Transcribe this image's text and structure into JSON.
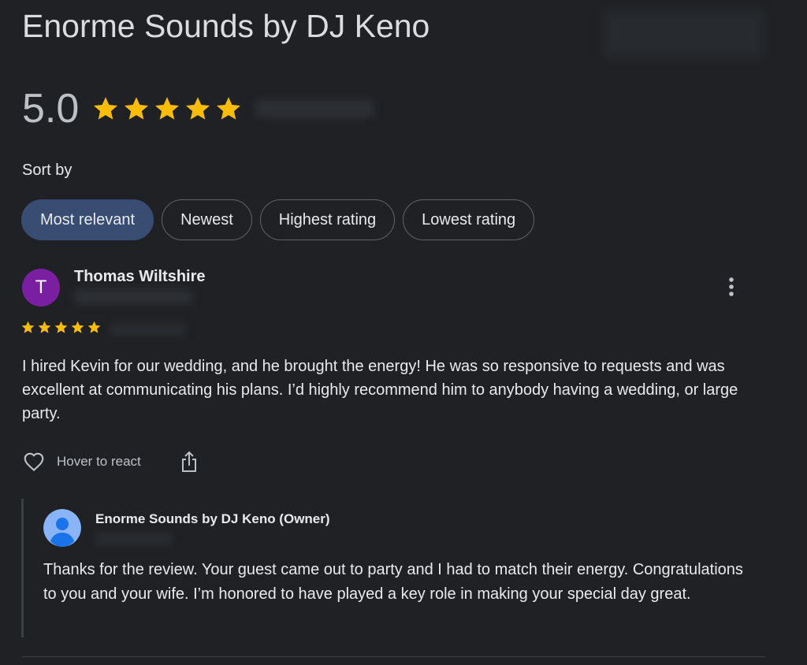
{
  "business": {
    "name": "Enorme Sounds by DJ Keno",
    "rating": "5.0",
    "stars": 5
  },
  "sort": {
    "label": "Sort by",
    "options": [
      {
        "label": "Most relevant",
        "selected": true
      },
      {
        "label": "Newest",
        "selected": false
      },
      {
        "label": "Highest rating",
        "selected": false
      },
      {
        "label": "Lowest rating",
        "selected": false
      }
    ]
  },
  "review": {
    "avatar_initial": "T",
    "avatar_color": "#7b1fa2",
    "reviewer_name": "Thomas Wiltshire",
    "stars": 5,
    "text": "I hired Kevin for our wedding, and he brought the energy! He was so responsive to requests and was excellent at communicating his plans. I’d highly recommend him to anybody having a wedding, or large party.",
    "react_label": "Hover to react",
    "icons": [
      "heart-outline-icon",
      "share-icon",
      "more-vert-icon"
    ]
  },
  "owner_reply": {
    "name": "Enorme Sounds by DJ Keno (Owner)",
    "text": "Thanks for the review. Your guest came out to party and I had to match their energy. Congratulations to you and your wife. I’m honored to have played a key role in making your special day great.",
    "avatar_icon": "default-profile-icon"
  },
  "colors": {
    "background": "#202124",
    "star": "#fbbc04",
    "selected_chip": "#394d73",
    "avatar_blue": "#8ab4f8"
  }
}
